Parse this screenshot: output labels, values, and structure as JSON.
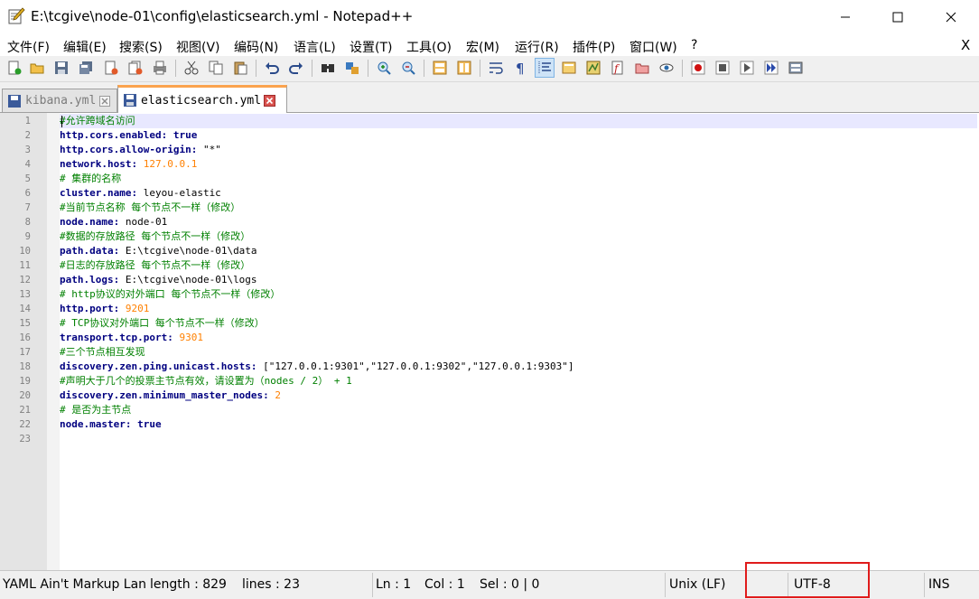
{
  "window": {
    "title": "E:\\tcgive\\node-01\\config\\elasticsearch.yml - Notepad++",
    "icon": "notepad-plus-plus-icon"
  },
  "menu": {
    "items": [
      "文件(F)",
      "编辑(E)",
      "搜索(S)",
      "视图(V)",
      "编码(N)",
      "语言(L)",
      "设置(T)",
      "工具(O)",
      "宏(M)",
      "运行(R)",
      "插件(P)",
      "窗口(W)",
      "?"
    ],
    "close_label": "X"
  },
  "tabs": [
    {
      "label": "kibana.yml",
      "active": false
    },
    {
      "label": "elasticsearch.yml",
      "active": true
    }
  ],
  "editor": {
    "current_line": 1,
    "lines": [
      [
        {
          "t": "#允许跨域名访问",
          "c": "cmt"
        }
      ],
      [
        {
          "t": "http.cors.enabled:",
          "c": "key"
        },
        {
          "t": " ",
          "c": "val"
        },
        {
          "t": "true",
          "c": "bool"
        }
      ],
      [
        {
          "t": "http.cors.allow-origin:",
          "c": "key"
        },
        {
          "t": " \"*\"",
          "c": "val"
        }
      ],
      [
        {
          "t": "network.host:",
          "c": "key"
        },
        {
          "t": " ",
          "c": "val"
        },
        {
          "t": "127.0.0.1",
          "c": "num"
        }
      ],
      [
        {
          "t": "# 集群的名称",
          "c": "cmt"
        }
      ],
      [
        {
          "t": "cluster.name:",
          "c": "key"
        },
        {
          "t": " leyou-elastic",
          "c": "val"
        }
      ],
      [
        {
          "t": "#当前节点名称 每个节点不一样（修改）",
          "c": "cmt"
        }
      ],
      [
        {
          "t": "node.name:",
          "c": "key"
        },
        {
          "t": " node-01",
          "c": "val"
        }
      ],
      [
        {
          "t": "#数据的存放路径 每个节点不一样（修改）",
          "c": "cmt"
        }
      ],
      [
        {
          "t": "path.data:",
          "c": "key"
        },
        {
          "t": " E:\\tcgive\\node-01\\data",
          "c": "val"
        }
      ],
      [
        {
          "t": "#日志的存放路径 每个节点不一样（修改）",
          "c": "cmt"
        }
      ],
      [
        {
          "t": "path.logs:",
          "c": "key"
        },
        {
          "t": " E:\\tcgive\\node-01\\logs",
          "c": "val"
        }
      ],
      [
        {
          "t": "# http协议的对外端口 每个节点不一样（修改）",
          "c": "cmt"
        }
      ],
      [
        {
          "t": "http.port:",
          "c": "key"
        },
        {
          "t": " ",
          "c": "val"
        },
        {
          "t": "9201",
          "c": "num"
        }
      ],
      [
        {
          "t": "# TCP协议对外端口 每个节点不一样（修改）",
          "c": "cmt"
        }
      ],
      [
        {
          "t": "transport.tcp.port:",
          "c": "key"
        },
        {
          "t": " ",
          "c": "val"
        },
        {
          "t": "9301",
          "c": "num"
        }
      ],
      [
        {
          "t": "#三个节点相互发现",
          "c": "cmt"
        }
      ],
      [
        {
          "t": "discovery.zen.ping.unicast.hosts:",
          "c": "key"
        },
        {
          "t": " [\"127.0.0.1:9301\",\"127.0.0.1:9302\",\"127.0.0.1:9303\"]",
          "c": "val"
        }
      ],
      [
        {
          "t": "#声明大于几个的投票主节点有效，请设置为（nodes / 2） + 1",
          "c": "cmt"
        }
      ],
      [
        {
          "t": "discovery.zen.minimum_master_nodes:",
          "c": "key"
        },
        {
          "t": " ",
          "c": "val"
        },
        {
          "t": "2",
          "c": "num"
        }
      ],
      [
        {
          "t": "# 是否为主节点",
          "c": "cmt"
        }
      ],
      [
        {
          "t": "node.master:",
          "c": "key"
        },
        {
          "t": " ",
          "c": "val"
        },
        {
          "t": "true",
          "c": "bool"
        }
      ],
      []
    ]
  },
  "status": {
    "language": "YAML Ain't Markup Language",
    "length": "length : 829",
    "lines": "lines : 23",
    "ln": "Ln : 1",
    "col": "Col : 1",
    "sel": "Sel : 0 | 0",
    "eol": "Unix (LF)",
    "encoding": "UTF-8",
    "mode": "INS"
  },
  "colors": {
    "highlight_box": "#e01b1b",
    "active_tab_accent": "#fba34e",
    "comment": "#008000",
    "key": "#000080",
    "number": "#ff8000",
    "current_line": "#e8e8ff"
  }
}
